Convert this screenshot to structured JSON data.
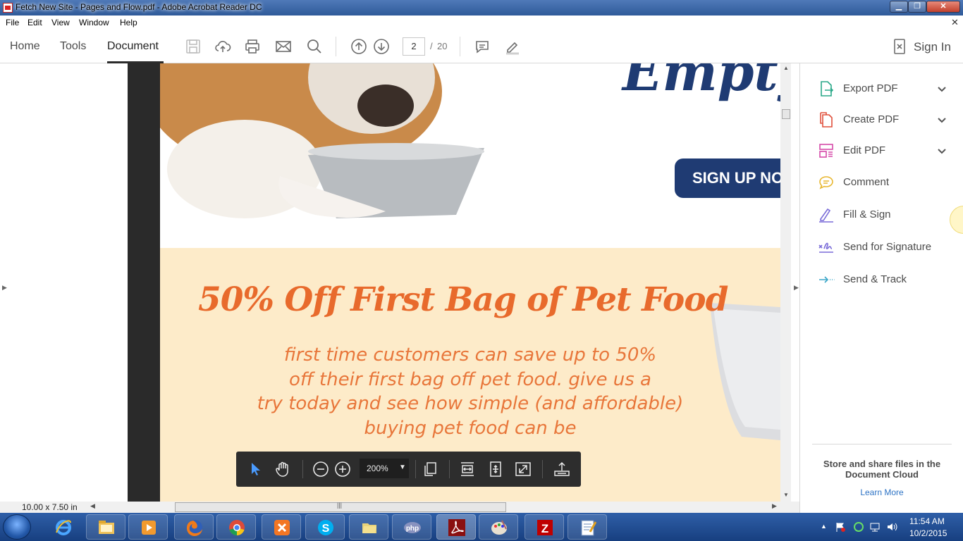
{
  "window": {
    "title": "Fetch New Site - Pages and Flow.pdf - Adobe Acrobat Reader DC"
  },
  "menu": [
    "File",
    "Edit",
    "View",
    "Window",
    "Help"
  ],
  "toolbar": {
    "tabs": [
      "Home",
      "Tools",
      "Document"
    ],
    "active_tab": "Document",
    "page_current": "2",
    "page_separator": "/",
    "page_total": "20",
    "sign_in": "Sign In",
    "icons": [
      "save-icon",
      "upload-cloud-icon",
      "print-icon",
      "email-icon",
      "search-icon",
      "page-up-icon",
      "page-down-icon",
      "comment-icon",
      "highlight-pen-icon",
      "sign-in-icon"
    ]
  },
  "document": {
    "top_heading_fragment": "Empty B",
    "signup_button": "SIGN UP NO",
    "headline": "50% Off First Bag of Pet Food",
    "body_lines": [
      "first time customers can save up to 50%",
      "off their first bag off pet food.  give us a",
      "try today and see how simple (and affordable)",
      "buying pet food can be"
    ],
    "colors": {
      "navy": "#1f3b73",
      "orange": "#e86a2c",
      "cream": "#fdebc9"
    }
  },
  "floating_toolbar": {
    "zoom": "200%",
    "icons": [
      "select-cursor-icon",
      "hand-pan-icon",
      "zoom-out-icon",
      "zoom-in-icon",
      "page-view-icon",
      "fit-width-icon",
      "fit-page-icon",
      "full-screen-icon",
      "share-upload-icon"
    ]
  },
  "status": {
    "page_size": "10.00 x 7.50 in"
  },
  "right_pane": {
    "items": [
      {
        "label": "Export PDF",
        "icon": "export-pdf-icon",
        "color": "#2aa889",
        "has_chevron": true
      },
      {
        "label": "Create PDF",
        "icon": "create-pdf-icon",
        "color": "#e0503c",
        "has_chevron": true
      },
      {
        "label": "Edit PDF",
        "icon": "edit-pdf-icon",
        "color": "#d54aa8",
        "has_chevron": true
      },
      {
        "label": "Comment",
        "icon": "comment-icon",
        "color": "#e8b730",
        "has_chevron": false
      },
      {
        "label": "Fill & Sign",
        "icon": "fill-sign-icon",
        "color": "#7a6cd8",
        "has_chevron": false
      },
      {
        "label": "Send for Signature",
        "icon": "send-signature-icon",
        "color": "#7a6cd8",
        "has_chevron": false
      },
      {
        "label": "Send & Track",
        "icon": "send-track-icon",
        "color": "#3aa6c8",
        "has_chevron": false
      }
    ],
    "cloud_promo": "Store and share files in the Document Cloud",
    "learn_more": "Learn More"
  },
  "taskbar": {
    "apps": [
      "internet-explorer-icon",
      "file-explorer-icon",
      "media-player-icon",
      "firefox-icon",
      "chrome-icon",
      "xampp-icon",
      "skype-icon",
      "folder-icon",
      "php-icon",
      "acrobat-icon",
      "paint-icon",
      "filezilla-icon",
      "notepad-icon"
    ],
    "time": "11:54 AM",
    "date": "10/2/2015"
  }
}
